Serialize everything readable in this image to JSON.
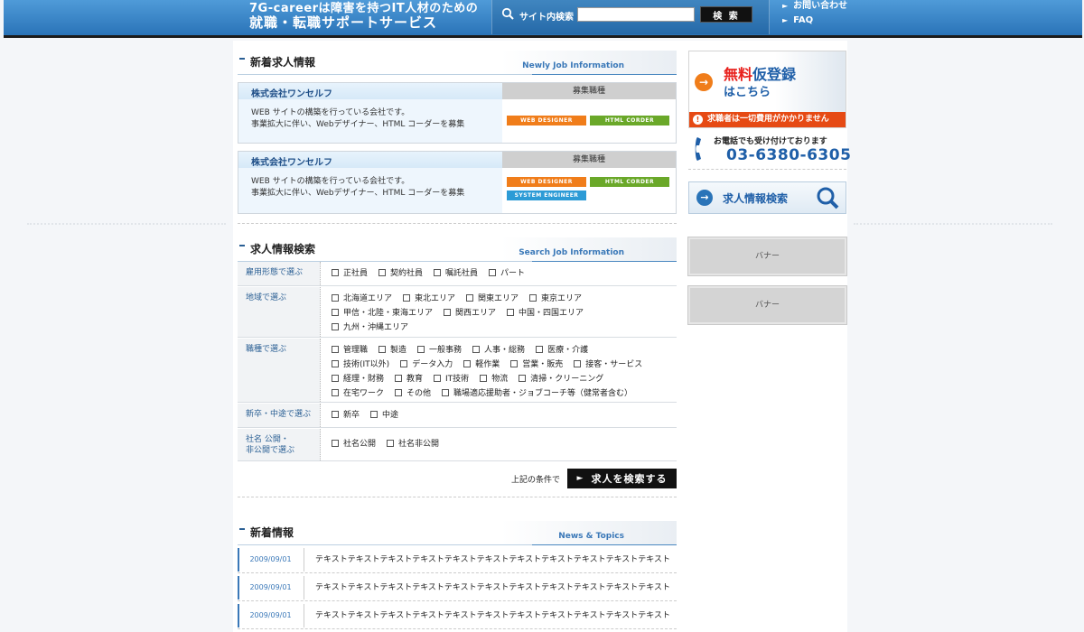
{
  "header": {
    "title_line1": "7G-careerは障害を持つIT人材のための",
    "title_line2": "就職・転職サポートサービス",
    "search_label": "サイト内検索",
    "search_value": "",
    "search_button": "検 索",
    "links": [
      "お問い合わせ",
      "FAQ"
    ]
  },
  "new_jobs": {
    "title": "新着求人情報",
    "subtitle": "Newly Job Information",
    "items": [
      {
        "company": "株式会社ワンセルフ",
        "job_type_label": "募集職種",
        "desc_line1": "WEB サイトの構築を行っている会社です。",
        "desc_line2": "事業拡大に伴い、Webデザイナー、HTML コーダーを募集",
        "tags": [
          "WEB DESIGNER",
          "HTML CORDER"
        ]
      },
      {
        "company": "株式会社ワンセルフ",
        "job_type_label": "募集職種",
        "desc_line1": "WEB サイトの構築を行っている会社です。",
        "desc_line2": "事業拡大に伴い、Webデザイナー、HTML コーダーを募集",
        "tags": [
          "WEB DESIGNER",
          "HTML CORDER",
          "SYSTEM ENGINEER"
        ]
      }
    ]
  },
  "job_search": {
    "title": "求人情報検索",
    "subtitle": "Search Job Information",
    "rows": [
      {
        "label": "雇用形態で選ぶ",
        "options": [
          "正社員",
          "契約社員",
          "嘱託社員",
          "パート"
        ]
      },
      {
        "label": "地域で選ぶ",
        "options": [
          "北海道エリア",
          "東北エリア",
          "関東エリア",
          "東京エリア",
          "甲信・北陸・東海エリア",
          "関西エリア",
          "中国・四国エリア",
          "九州・沖縄エリア"
        ]
      },
      {
        "label": "職種で選ぶ",
        "options": [
          "管理職",
          "製造",
          "一般事務",
          "人事・総務",
          "医療・介護",
          "技術(IT以外)",
          "データ入力",
          "軽作業",
          "営業・販売",
          "接客・サービス",
          "経理・財務",
          "教育",
          "IT技術",
          "物流",
          "清掃・クリーニング",
          "在宅ワーク",
          "その他",
          "職場適応援助者・ジョブコーチ等（健常者含む）"
        ]
      },
      {
        "label": "新卒・中途で選ぶ",
        "options": [
          "新卒",
          "中途"
        ]
      },
      {
        "label_line1": "社名 公開・",
        "label_line2": "非公開で選ぶ",
        "options": [
          "社名公開",
          "社名非公開"
        ]
      }
    ],
    "condition_text": "上記の条件で",
    "submit_button": "求人を検索する"
  },
  "news": {
    "title": "新着情報",
    "subtitle": "News & Topics",
    "items": [
      {
        "date": "2009/09/01",
        "text": "テキストテキストテキストテキストテキストテキストテキストテキストテキストテキストテキスト"
      },
      {
        "date": "2009/09/01",
        "text": "テキストテキストテキストテキストテキストテキストテキストテキストテキストテキストテキスト"
      },
      {
        "date": "2009/09/01",
        "text": "テキストテキストテキストテキストテキストテキストテキストテキストテキストテキストテキスト"
      }
    ]
  },
  "sidebar": {
    "register_red": "無料",
    "register_blue": "仮登録",
    "register_line2": "はこちら",
    "register_note": "求職者は一切費用がかかりません",
    "tel_lead": "お電話でも受け付けております",
    "tel_number": "03-6380-6305",
    "job_search_banner": "求人情報検索",
    "banners": [
      "バナー",
      "バナー"
    ]
  },
  "colors": {
    "brand": "#2a74b8",
    "accent": "#f07d1a",
    "alert": "#e64a14"
  }
}
